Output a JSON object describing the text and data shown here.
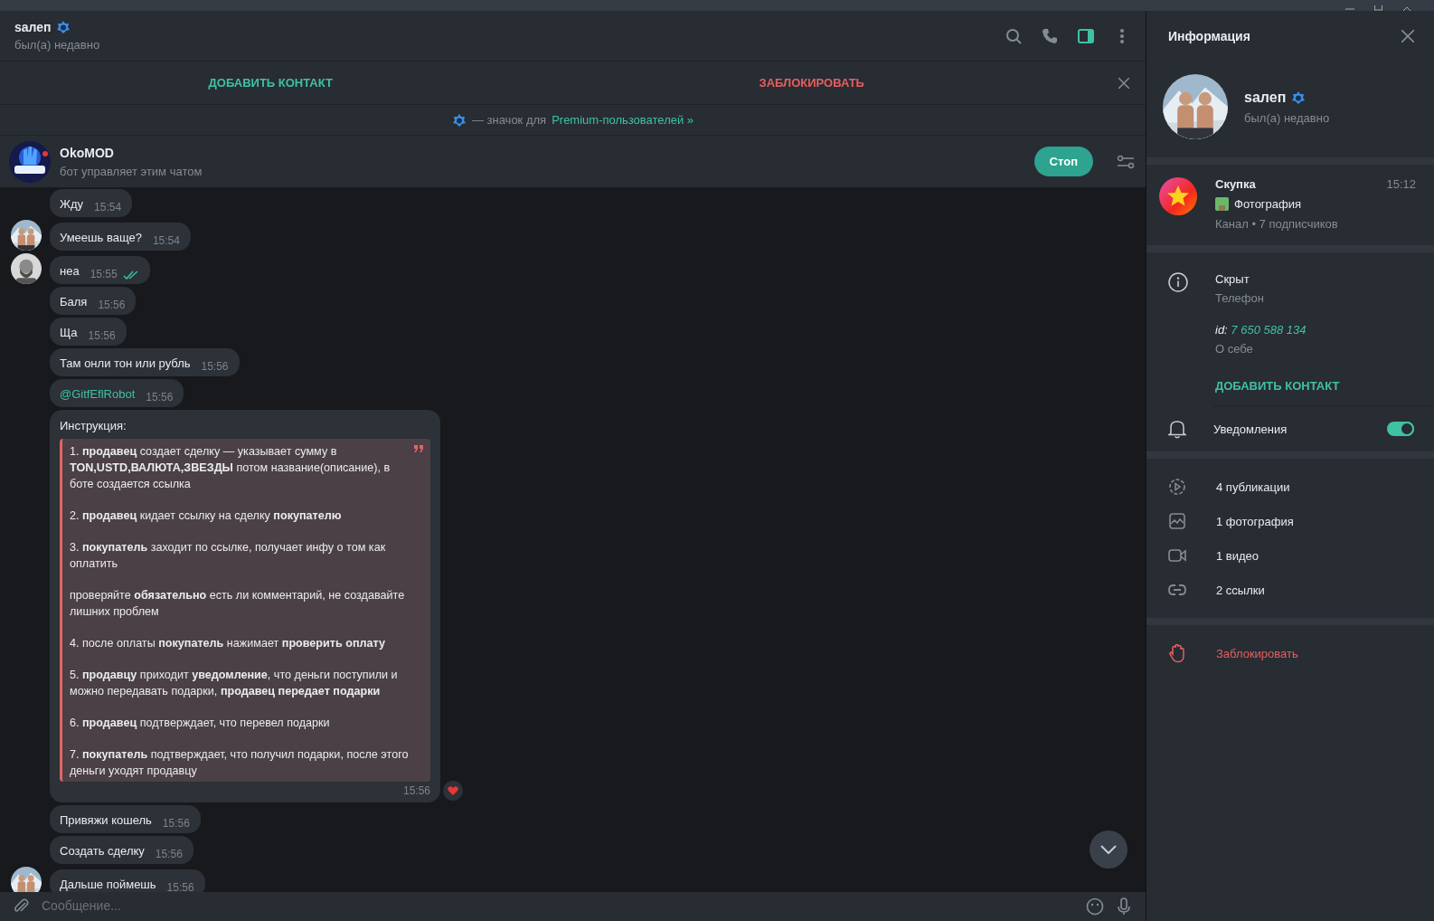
{
  "header": {
    "name": "sалеп",
    "status": "был(а) недавно",
    "toolbar": [
      {
        "kind": "search",
        "selected": false
      },
      {
        "kind": "call",
        "selected": false
      },
      {
        "kind": "panel",
        "selected": true
      },
      {
        "kind": "more",
        "selected": false
      }
    ]
  },
  "action_bar": {
    "add_contact": "ДОБАВИТЬ КОНТАКТ",
    "block": "ЗАБЛОКИРОВАТЬ"
  },
  "premium_notice": {
    "text": "— значок для",
    "link": "Premium-пользователей »"
  },
  "bot_bar": {
    "name": "OkoMOD",
    "subtitle": "бот управляет этим чатом",
    "button": "Стоп"
  },
  "messages": [
    {
      "kind": "text",
      "text": "Жду",
      "time": "15:54",
      "read": false,
      "reacted": false
    },
    {
      "kind": "text",
      "text": "Умеешь ваще?",
      "time": "15:54",
      "avatar": {
        "kind": "contact"
      },
      "read": false,
      "reacted": false
    },
    {
      "kind": "text",
      "text": "неа",
      "time": "15:55",
      "avatar": {
        "kind": "self"
      },
      "read": true,
      "reacted": false
    },
    {
      "kind": "text",
      "text": "Баля",
      "time": "15:56",
      "read": false,
      "reacted": false
    },
    {
      "kind": "text",
      "text": "Ща",
      "time": "15:56",
      "read": false,
      "reacted": false
    },
    {
      "kind": "text",
      "text": "Там онли тон или рубль",
      "time": "15:56",
      "read": false,
      "reacted": false
    },
    {
      "kind": "link",
      "text": "@GitfEflRobot",
      "time": "15:56",
      "read": false,
      "reacted": false
    },
    {
      "kind": "instruction",
      "text": "Инструкция:",
      "time": "15:56",
      "read": false,
      "reacted": true,
      "quote": [
        "1. **продавец** создает сделку — указывает сумму в **TON,USTD,ВАЛЮТА,ЗВЕЗДЫ** потом название(описание), в боте создается ссылка",
        "2. **продавец** кидает ссылку на сделку **покупателю**",
        "3. **покупатель** заходит по ссылке, получает инфу о том как оплатить",
        "проверяйте **обязательно** есть ли комментарий, не создавайте лишних проблем",
        "4. после оплаты **покупатель** нажимает **проверить оплату**",
        "5. **продавцу** приходит **уведомление**, что деньги поступили и можно передавать подарки, **продавец передает подарки**",
        "6. **продавец** подтверждает, что перевел подарки",
        "7. **покупатель** подтверждает, что получил подарки, после этого деньги уходят продавцу"
      ]
    },
    {
      "kind": "text",
      "text": "Привяжи кошель",
      "time": "15:56",
      "read": false,
      "reacted": false
    },
    {
      "kind": "text",
      "text": "Создать сделку",
      "time": "15:56",
      "read": false,
      "reacted": false
    },
    {
      "kind": "text",
      "text": "Дальше поймешь",
      "time": "15:56",
      "avatar": {
        "kind": "contact"
      },
      "read": false,
      "reacted": false
    }
  ],
  "composer": {
    "placeholder": "Сообщение..."
  },
  "info_panel": {
    "title": "Информация",
    "profile": {
      "name": "sалеп",
      "status": "был(а) недавно"
    },
    "channel": {
      "name": "Скупка",
      "time": "15:12",
      "preview": "Фотография",
      "meta": "Канал • 7 подписчиков"
    },
    "phone": {
      "value": "Скрыт",
      "label": "Телефон"
    },
    "bio": {
      "prefix": "id:",
      "link": "7 650 588 134",
      "label": "О себе"
    },
    "add_contact": "ДОБАВИТЬ КОНТАКТ",
    "notifications": {
      "label": "Уведомления",
      "on": true
    },
    "media": [
      {
        "kind": "posts",
        "label": "4 публикации"
      },
      {
        "kind": "photos",
        "label": "1 фотография"
      },
      {
        "kind": "videos",
        "label": "1 видео"
      },
      {
        "kind": "links",
        "label": "2 ссылки"
      }
    ],
    "block": "Заблокировать"
  }
}
